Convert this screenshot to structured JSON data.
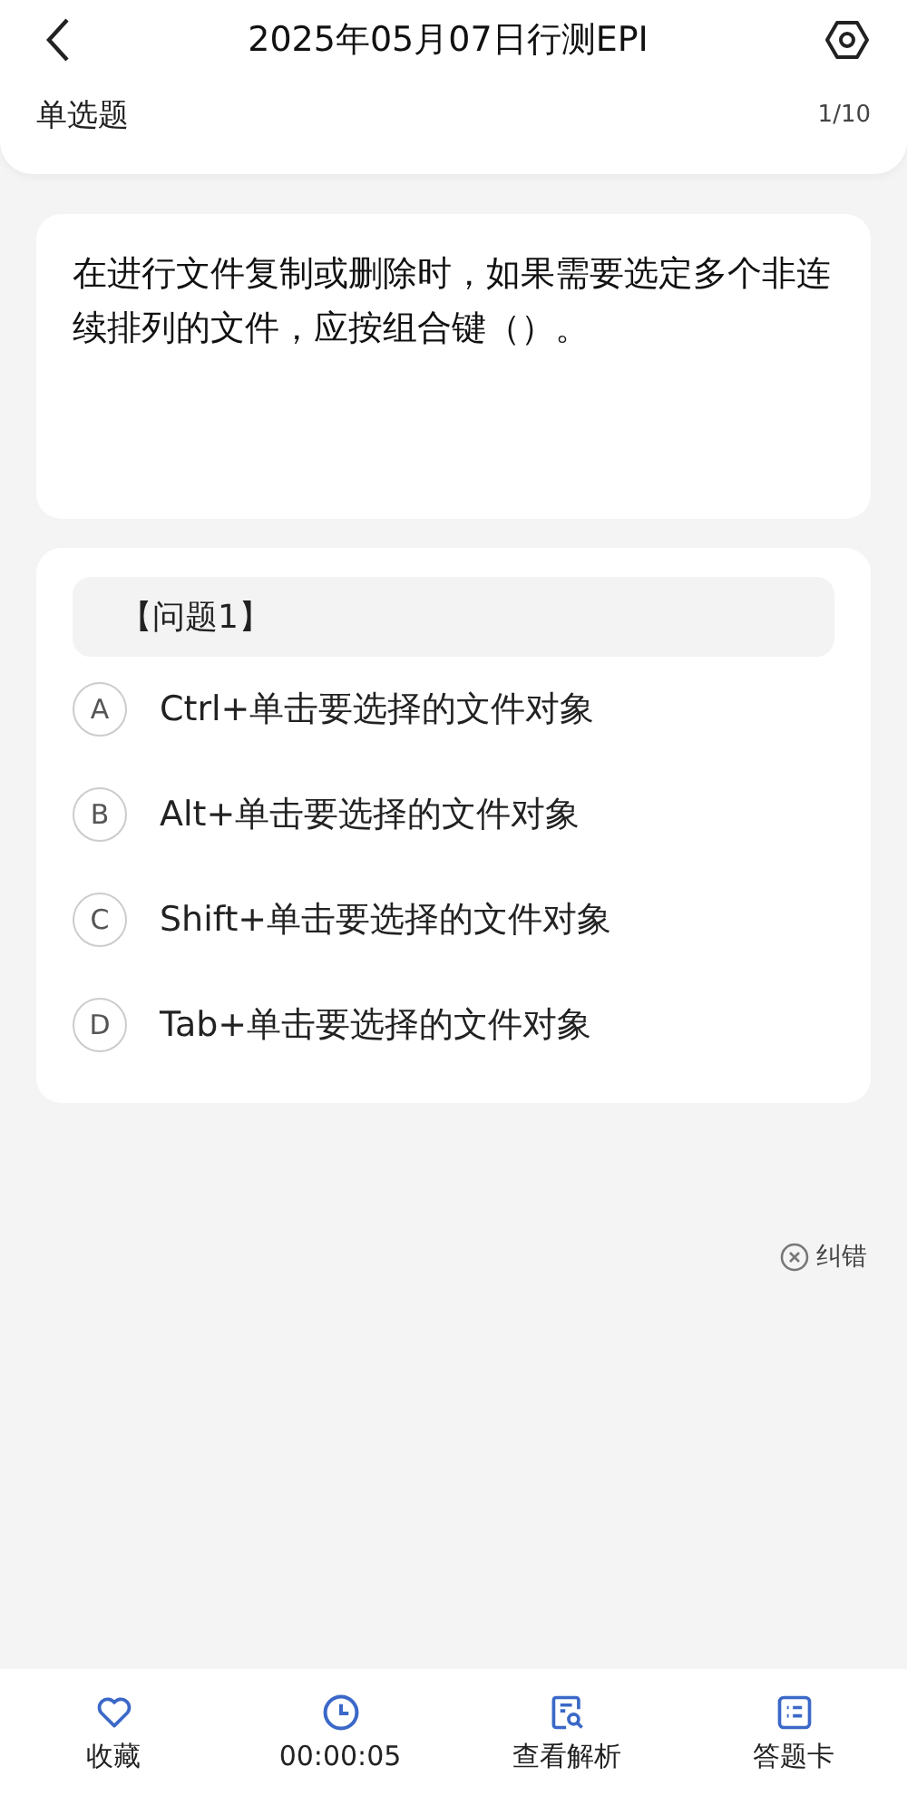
{
  "header": {
    "title": "2025年05月07日行测EPI",
    "question_type": "单选题",
    "progress": "1/10"
  },
  "question": {
    "text": "在进行文件复制或删除时，如果需要选定多个非连续排列的文件，应按组合键（）。"
  },
  "options_card": {
    "heading": "【问题1】",
    "options": [
      {
        "letter": "A",
        "text": "Ctrl+单击要选择的文件对象",
        "selected": false
      },
      {
        "letter": "B",
        "text": "Alt+单击要选择的文件对象",
        "selected": false
      },
      {
        "letter": "C",
        "text": "Shift+单击要选择的文件对象",
        "selected": false
      },
      {
        "letter": "D",
        "text": "Tab+单击要选择的文件对象",
        "selected": false
      }
    ]
  },
  "report_error": {
    "label": "纠错"
  },
  "bottom_bar": [
    {
      "kind": "favorite",
      "label": "收藏"
    },
    {
      "kind": "timer",
      "label": "00:00:05"
    },
    {
      "kind": "analysis",
      "label": "查看解析"
    },
    {
      "kind": "answer_sheet",
      "label": "答题卡"
    }
  ]
}
